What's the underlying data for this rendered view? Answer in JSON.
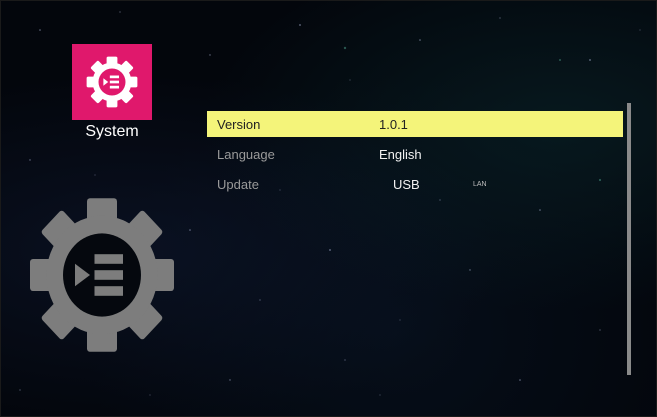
{
  "sidebar": {
    "title": "System",
    "icon": "system-settings-icon",
    "accent": "#e0186c"
  },
  "menu": {
    "items": [
      {
        "label": "Version",
        "value": "1.0.1"
      },
      {
        "label": "Language",
        "value": "English"
      },
      {
        "label": "Update",
        "value": "USB",
        "alt": "LAN"
      }
    ],
    "selected_index": 0,
    "highlight_color": "#f4f47a"
  }
}
